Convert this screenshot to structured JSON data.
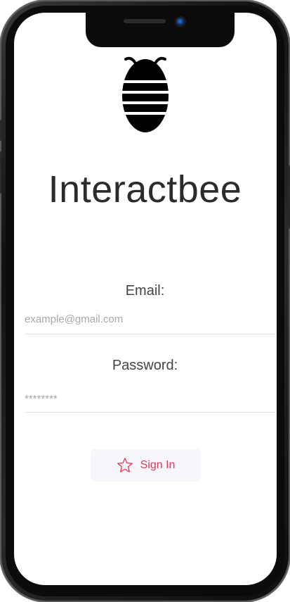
{
  "app": {
    "title": "Interactbee"
  },
  "login_form": {
    "email": {
      "label": "Email:",
      "placeholder": "example@gmail.com",
      "value": ""
    },
    "password": {
      "label": "Password:",
      "placeholder": "********",
      "value": ""
    },
    "submit": {
      "label": "Sign In",
      "icon": "star-outline-icon"
    }
  },
  "icons": {
    "logo": "bee-logo-icon"
  },
  "colors": {
    "accent": "#e0385a",
    "button_bg": "#f7f6fb",
    "title": "#2b2b2b",
    "placeholder": "#a8a8a8",
    "logo": "#000000"
  }
}
